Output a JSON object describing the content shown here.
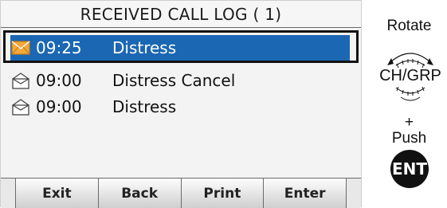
{
  "screen": {
    "title": "RECEIVED CALL LOG ( 1)",
    "rows": [
      {
        "time": "09:25",
        "message": "Distress",
        "icon": "envelope-unread-icon",
        "selected": true
      },
      {
        "time": "09:00",
        "message": "Distress Cancel",
        "icon": "envelope-read-icon",
        "selected": false
      },
      {
        "time": "09:00",
        "message": "Distress",
        "icon": "envelope-read-icon",
        "selected": false
      }
    ],
    "softkeys": [
      "Exit",
      "Back",
      "Print",
      "Enter"
    ]
  },
  "panel": {
    "rotate_label": "Rotate",
    "knob_label": "CH/GRP",
    "plus": "+",
    "push_label": "Push",
    "ent_label": "ENT"
  },
  "colors": {
    "selection": "#1b67b3",
    "unread_envelope": "#f2a93b"
  }
}
